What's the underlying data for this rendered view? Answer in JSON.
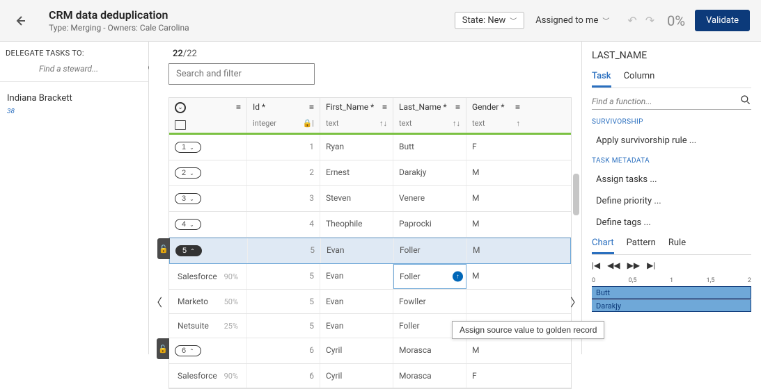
{
  "header": {
    "title": "CRM data deduplication",
    "subtitle": "Type: Merging - Owners: Cale Carolina",
    "state_label": "State: New",
    "assigned_label": "Assigned to me",
    "percent": "0%",
    "validate_label": "Validate"
  },
  "left": {
    "delegate_title": "DELEGATE TASKS TO:",
    "search_placeholder": "Find a steward...",
    "steward": "Indiana Brackett",
    "steward_count": "38"
  },
  "center": {
    "counter_current": "22",
    "counter_total": "/22",
    "filter_placeholder": "Search and filter",
    "columns": {
      "id": {
        "label": "Id *",
        "type": "integer"
      },
      "first": {
        "label": "First_Name *",
        "type": "text"
      },
      "last": {
        "label": "Last_Name *",
        "type": "text"
      },
      "gender": {
        "label": "Gender *",
        "type": "text"
      }
    },
    "rows": [
      {
        "grp": "1",
        "id": "1",
        "first": "Ryan",
        "last": "Butt",
        "gender": "F"
      },
      {
        "grp": "2",
        "id": "2",
        "first": "Ernest",
        "last": "Darakjy",
        "gender": "M"
      },
      {
        "grp": "3",
        "id": "3",
        "first": "Steven",
        "last": "Venere",
        "gender": "M"
      },
      {
        "grp": "4",
        "id": "4",
        "first": "Theophile",
        "last": "Paprocki",
        "gender": "M"
      },
      {
        "grp": "5",
        "id": "5",
        "first": "Evan",
        "last": "Foller",
        "gender": "M",
        "selected": true
      },
      {
        "src": "Salesforce",
        "pct": "90%",
        "id": "5",
        "first": "Evan",
        "last": "Foller",
        "gender": "M",
        "assign": true
      },
      {
        "src": "Marketo",
        "pct": "50%",
        "id": "5",
        "first": "Evan",
        "last": "Fowller",
        "gender": ""
      },
      {
        "src": "Netsuite",
        "pct": "25%",
        "id": "5",
        "first": "Evan",
        "last": "Foller",
        "gender": ""
      },
      {
        "grp": "6",
        "id": "6",
        "first": "Cyril",
        "last": "Morasca",
        "gender": "M"
      },
      {
        "src": "Salesforce",
        "pct": "90%",
        "id": "6",
        "first": "Cyril",
        "last": "Morasca",
        "gender": "F"
      }
    ],
    "tooltip": "Assign source value to golden record"
  },
  "right": {
    "column_name": "LAST_NAME",
    "tabs": {
      "task": "Task",
      "column": "Column"
    },
    "func_placeholder": "Find a function...",
    "section1": "SURVIVORSHIP",
    "func1": "Apply survivorship rule ...",
    "section2": "TASK METADATA",
    "func2": "Assign tasks ...",
    "func3": "Define priority ...",
    "func4": "Define tags ...",
    "tabs2": {
      "chart": "Chart",
      "pattern": "Pattern",
      "rule": "Rule"
    },
    "axis": [
      "0",
      "0,5",
      "1",
      "1,5",
      "2"
    ],
    "bars": [
      "Butt",
      "Darakjy"
    ]
  }
}
